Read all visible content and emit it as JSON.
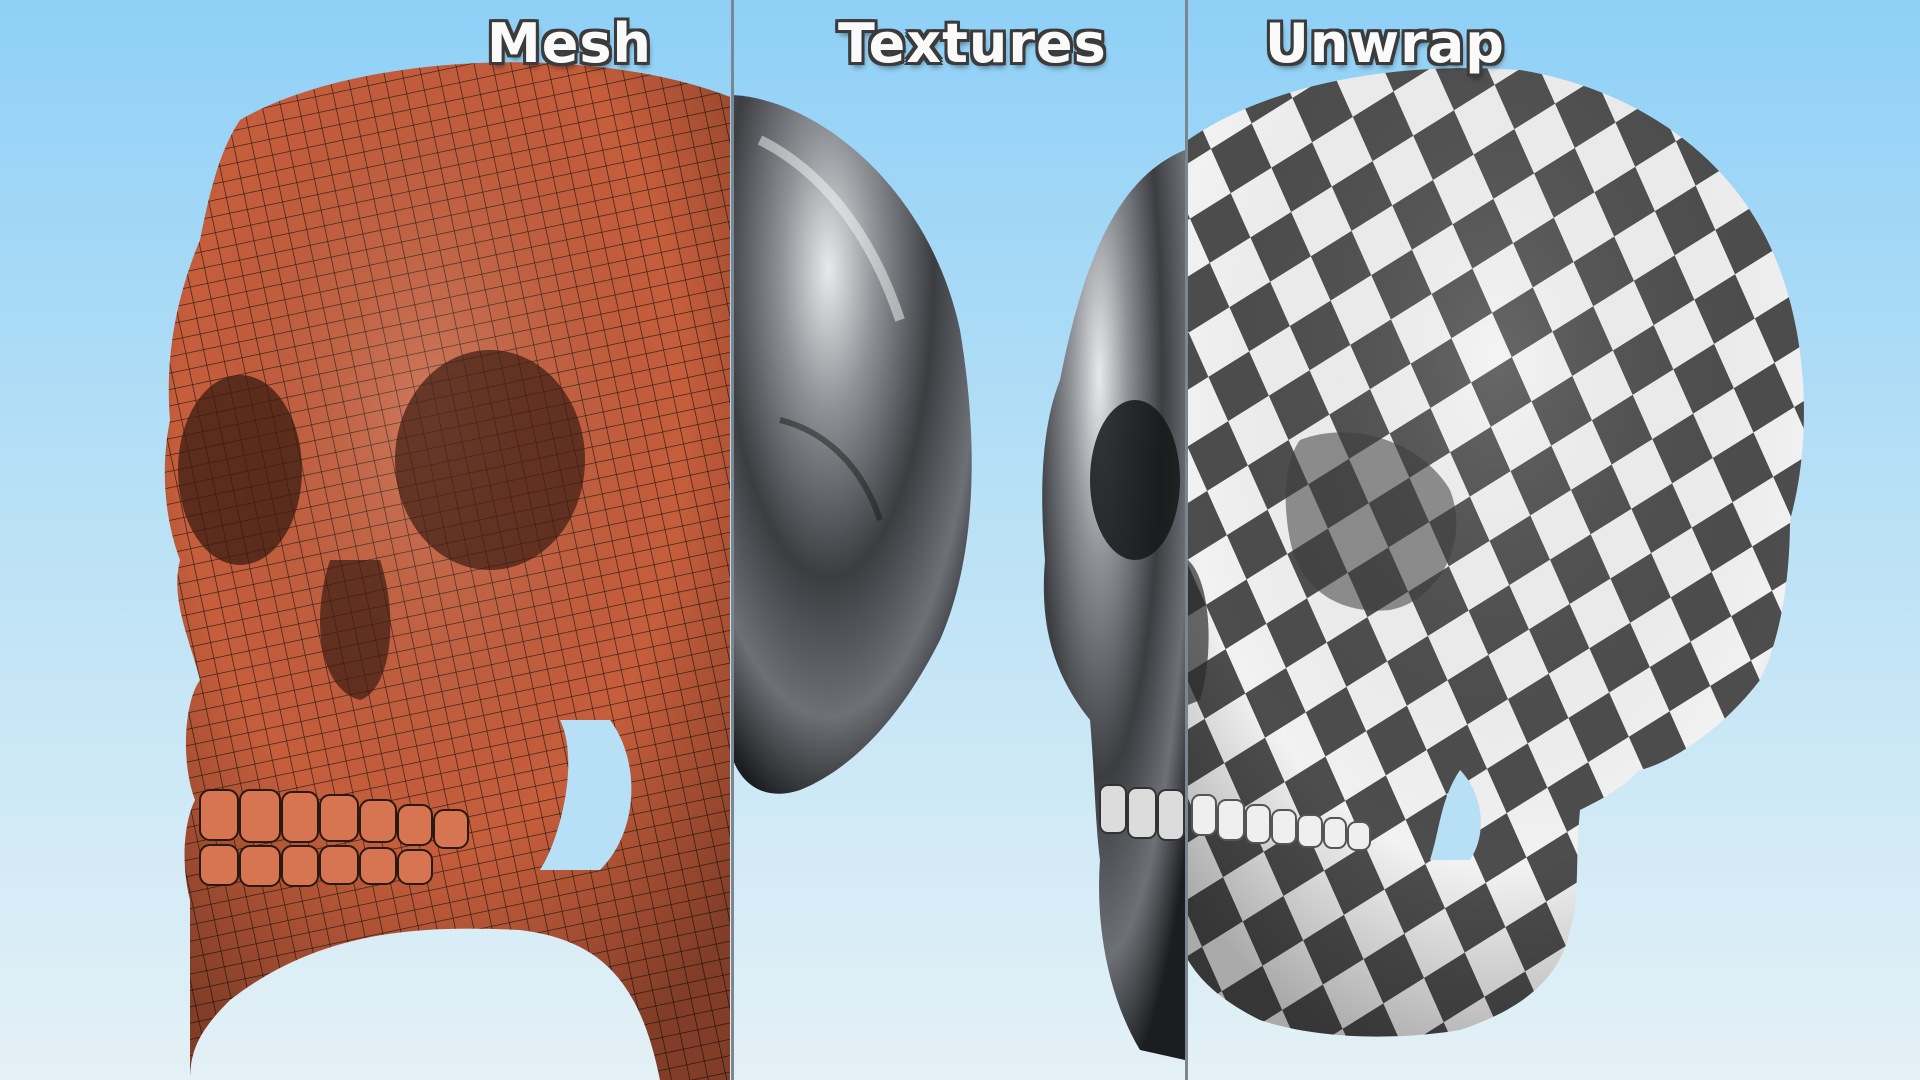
{
  "labels": {
    "mesh": "Mesh",
    "textures": "Textures",
    "unwrap": "Unwrap"
  },
  "colors": {
    "background_top": "#8fd0f7",
    "background_bottom": "#e4f1f6",
    "mesh_skull": "#c65e3c",
    "mesh_wire": "#2a1a14",
    "metal_skull": "#4a4d52",
    "checker_dark": "#4d4d4d",
    "checker_light": "#f2f2f2",
    "divider": "#7a8790"
  }
}
